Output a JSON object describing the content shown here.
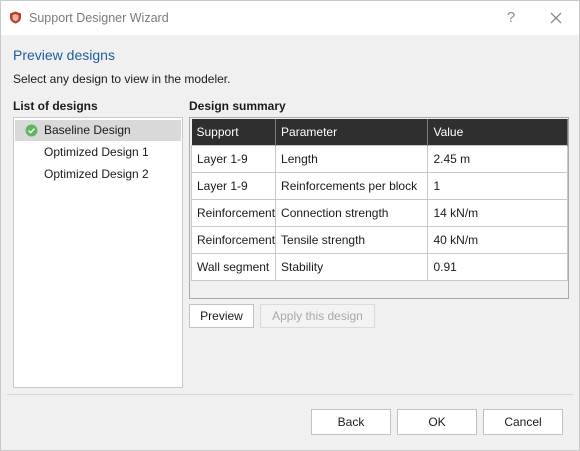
{
  "window": {
    "title": "Support Designer Wizard",
    "help_label": "?"
  },
  "page": {
    "heading": "Preview designs",
    "subheading": "Select any design to view in the modeler."
  },
  "designs": {
    "label": "List of designs",
    "items": [
      {
        "label": "Baseline Design",
        "selected": true
      },
      {
        "label": "Optimized Design 1",
        "selected": false
      },
      {
        "label": "Optimized Design 2",
        "selected": false
      }
    ]
  },
  "summary": {
    "label": "Design summary",
    "columns": [
      "Support",
      "Parameter",
      "Value"
    ],
    "rows": [
      [
        "Layer 1-9",
        "Length",
        "2.45 m"
      ],
      [
        "Layer 1-9",
        "Reinforcements per block",
        "1"
      ],
      [
        "Reinforcement",
        "Connection strength",
        "14 kN/m"
      ],
      [
        "Reinforcement",
        "Tensile strength",
        "40 kN/m"
      ],
      [
        "Wall segment",
        "Stability",
        "0.91"
      ]
    ]
  },
  "actions": {
    "preview": "Preview",
    "apply": "Apply this design"
  },
  "footer": {
    "back": "Back",
    "ok": "OK",
    "cancel": "Cancel"
  },
  "colors": {
    "accent": "#1c5c9c",
    "header_bg": "#2f2f2f",
    "check": "#5cb85c",
    "selected_bg": "#d9d9d9"
  },
  "icons": {
    "app": "shield-icon",
    "help": "help-icon",
    "close": "close-icon",
    "selected_design": "check-circle-icon"
  }
}
